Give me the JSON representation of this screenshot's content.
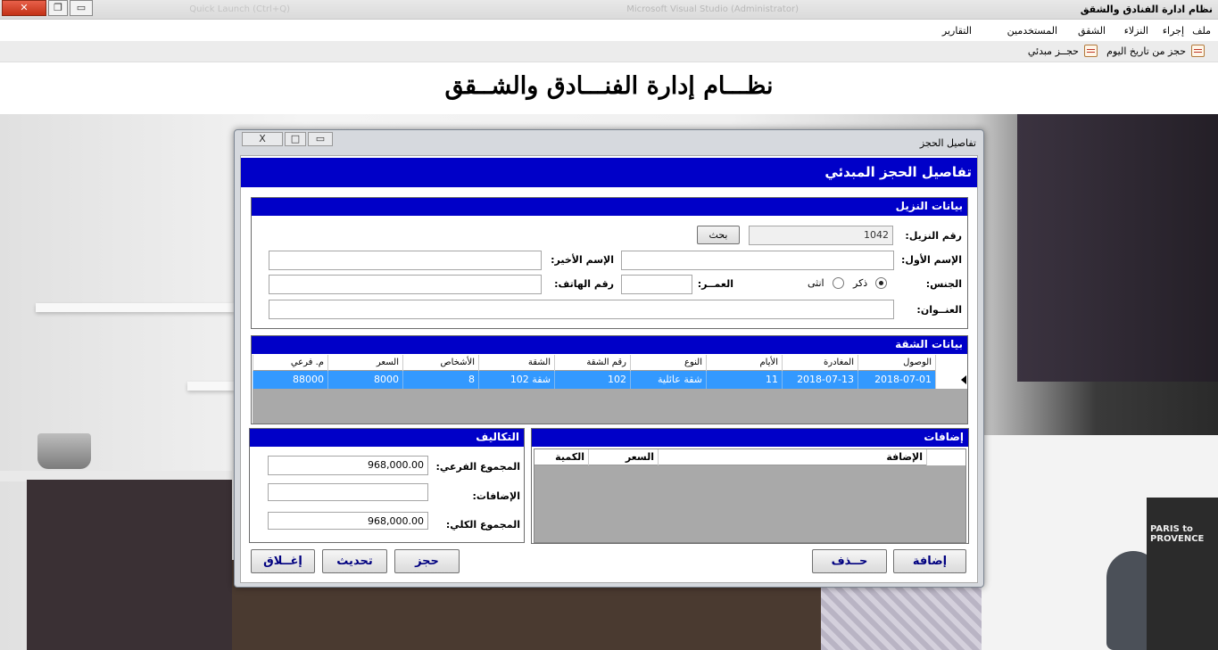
{
  "window": {
    "title": "نظام ادارة الفنادق والشقق",
    "ghost_text": "Microsoft Visual Studio (Administrator)",
    "ghost_text2": "Quick Launch (Ctrl+Q)",
    "close_glyph": "✕",
    "restore_glyph": "❐",
    "min_glyph": "▭"
  },
  "menu": {
    "items": [
      "ملف",
      "إجراء",
      "النزلاء",
      "الشقق",
      "المستخدمين",
      "التقارير"
    ]
  },
  "toolbar": {
    "today_booking": "حجز من تاريخ اليوم",
    "initial_booking": "حجــز مبدئي"
  },
  "header": {
    "title": "نظـــام إدارة الفنـــادق والشــقق"
  },
  "background": {
    "book_text": "PARIS to PROVENCE"
  },
  "dialog": {
    "title": "تفاصيل الحجز",
    "banner": "تفاصيل الحجز المبدئي",
    "close_glyph": "X",
    "restore_glyph": "□",
    "min_glyph": "▭",
    "guest": {
      "heading": "بيانات النزيل",
      "guest_no_label": "رقم النزيل:",
      "guest_no_value": "1042",
      "search_button": "بحث",
      "first_name_label": "الإسم الأول:",
      "first_name_value": "",
      "last_name_label": "الإسم الأخير:",
      "last_name_value": "",
      "gender_label": "الجنس:",
      "male_label": "ذكر",
      "female_label": "انثى",
      "age_label": "العمــر:",
      "age_value": "",
      "phone_label": "رقم الهاتف:",
      "phone_value": "",
      "address_label": "العنــوان:",
      "address_value": ""
    },
    "apartment": {
      "heading": "بيانات الشقة",
      "columns": [
        "الوصول",
        "المغادرة",
        "الأيام",
        "النوع",
        "رقم الشقة",
        "الشقة",
        "الأشخاص",
        "السعر",
        "م. فرعي"
      ],
      "rows": [
        [
          "2018-07-01",
          "2018-07-13",
          "11",
          "شقة عائلية",
          "102",
          "شقة 102",
          "8",
          "8000",
          "88000"
        ]
      ]
    },
    "costs": {
      "heading": "التكاليف",
      "subtotal_label": "المجموع الفرعي:",
      "subtotal_value": "968,000.00",
      "extras_label": "الإضافات:",
      "extras_value": "",
      "total_label": "المجموع الكلي:",
      "total_value": "968,000.00"
    },
    "extras": {
      "heading": "إضافات",
      "columns": [
        "الإضافة",
        "السعر",
        "الكمية"
      ]
    },
    "buttons": {
      "add": "إضافة",
      "delete": "حــذف",
      "book": "حجز",
      "update": "تحديث",
      "close": "إغــلاق"
    }
  }
}
